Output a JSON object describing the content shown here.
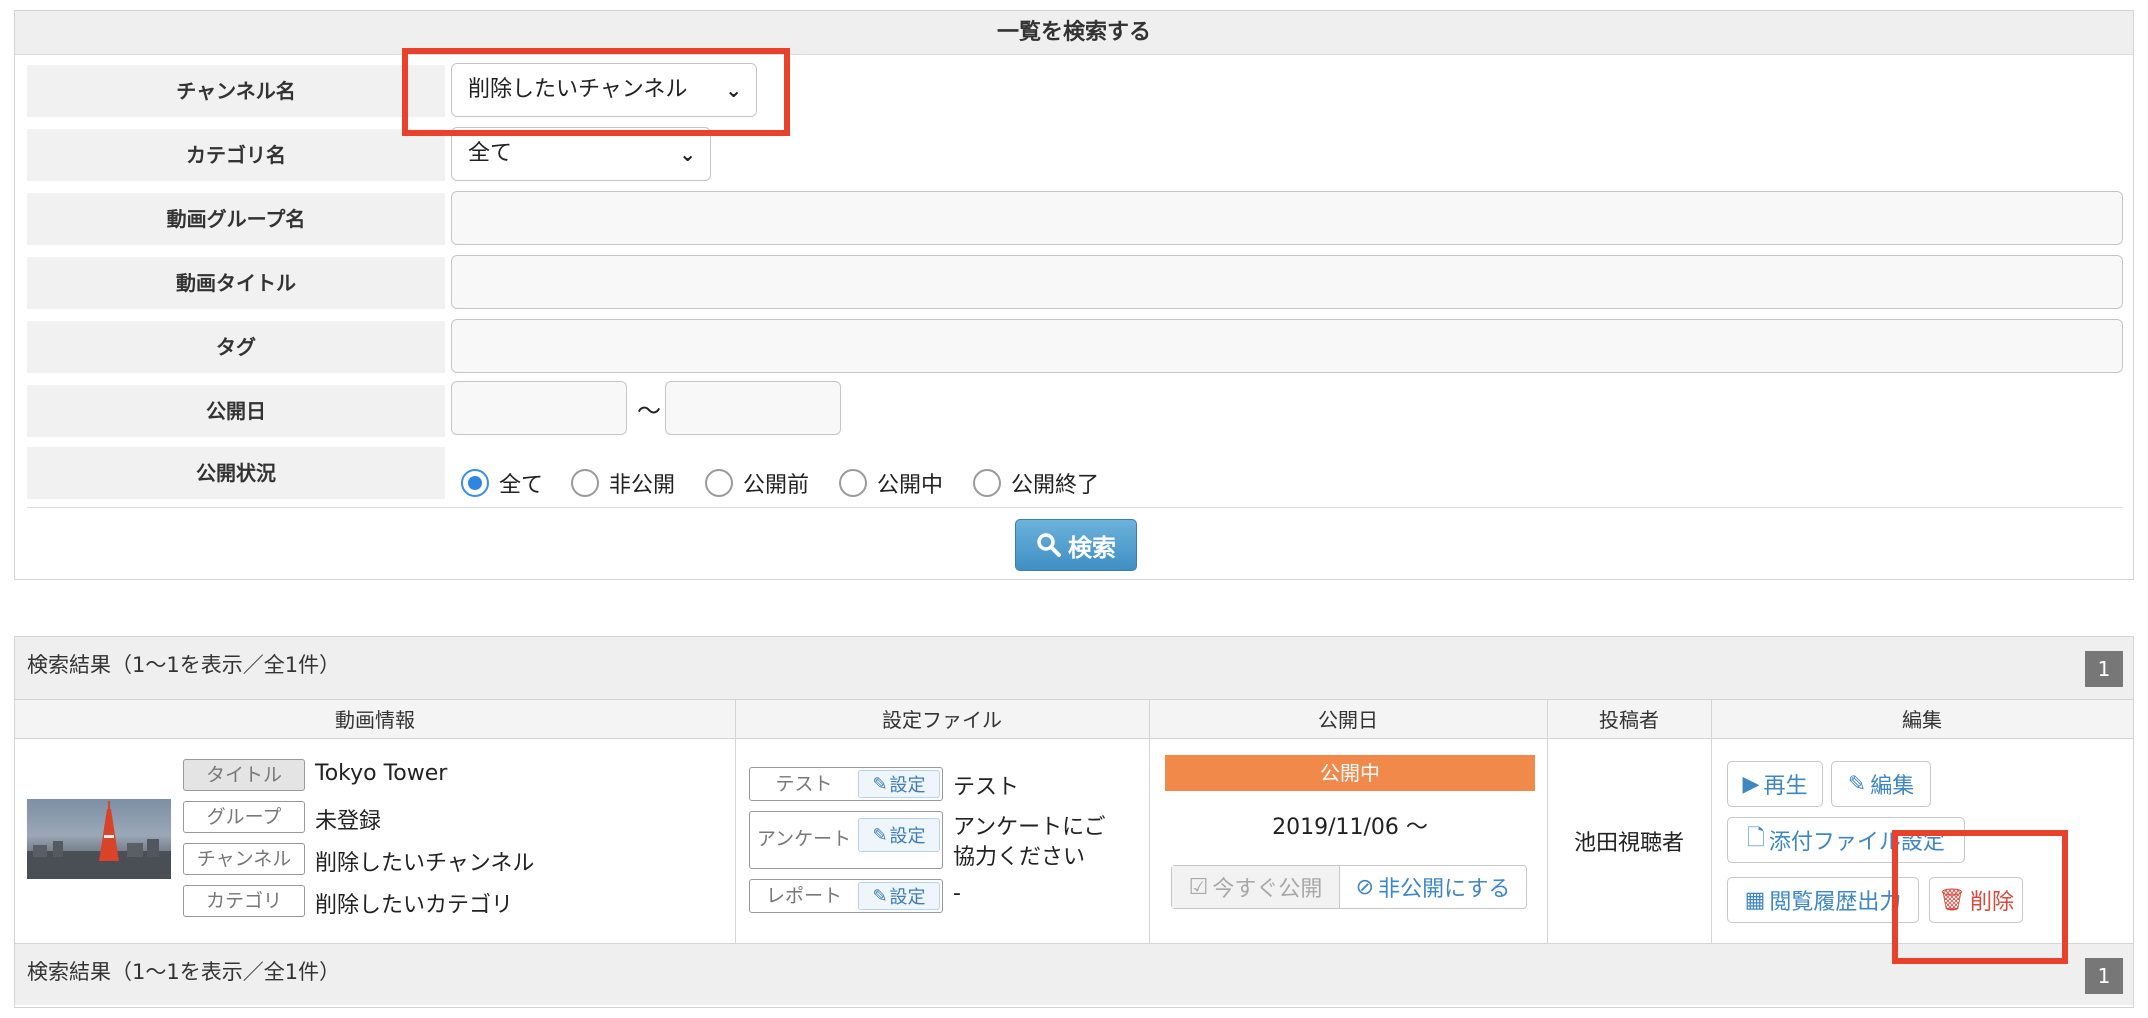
{
  "search": {
    "header": "一覧を検索する",
    "labels": {
      "channel": "チャンネル名",
      "category": "カテゴリ名",
      "group": "動画グループ名",
      "title": "動画タイトル",
      "tag": "タグ",
      "date": "公開日",
      "status": "公開状況"
    },
    "channel_value": "削除したいチャンネル",
    "category_value": "全て",
    "date_separator": "〜",
    "status_options": [
      "全て",
      "非公開",
      "公開前",
      "公開中",
      "公開終了"
    ],
    "status_selected": "全て",
    "button": "検索"
  },
  "results": {
    "summary": "検索結果（1〜1を表示／全1件）",
    "page": "1",
    "columns": [
      "動画情報",
      "設定ファイル",
      "公開日",
      "投稿者",
      "編集"
    ],
    "row": {
      "info": [
        {
          "label": "タイトル",
          "value": "Tokyo Tower"
        },
        {
          "label": "グループ",
          "value": "未登録"
        },
        {
          "label": "チャンネル",
          "value": "削除したいチャンネル"
        },
        {
          "label": "カテゴリ",
          "value": "削除したいカテゴリ"
        }
      ],
      "files": [
        {
          "name": "テスト",
          "button": "設定",
          "value": "テスト"
        },
        {
          "name": "アンケート",
          "button": "設定",
          "value_line1": "アンケートにご",
          "value_line2": "協力ください"
        },
        {
          "name": "レポート",
          "button": "設定",
          "value": "-"
        }
      ],
      "status_badge": "公開中",
      "publish_date": "2019/11/06 〜",
      "publish_now": "今すぐ公開",
      "unpublish": "非公開にする",
      "poster": "池田視聴者",
      "actions": {
        "play": "再生",
        "edit": "編集",
        "attach": "添付ファイル設定",
        "history": "閲覧履歴出力",
        "delete": "削除"
      }
    }
  },
  "colors": {
    "highlight": "#e8412c",
    "status_badge": "#f0894a",
    "link": "#3d87c4",
    "delete": "#d9483b"
  }
}
